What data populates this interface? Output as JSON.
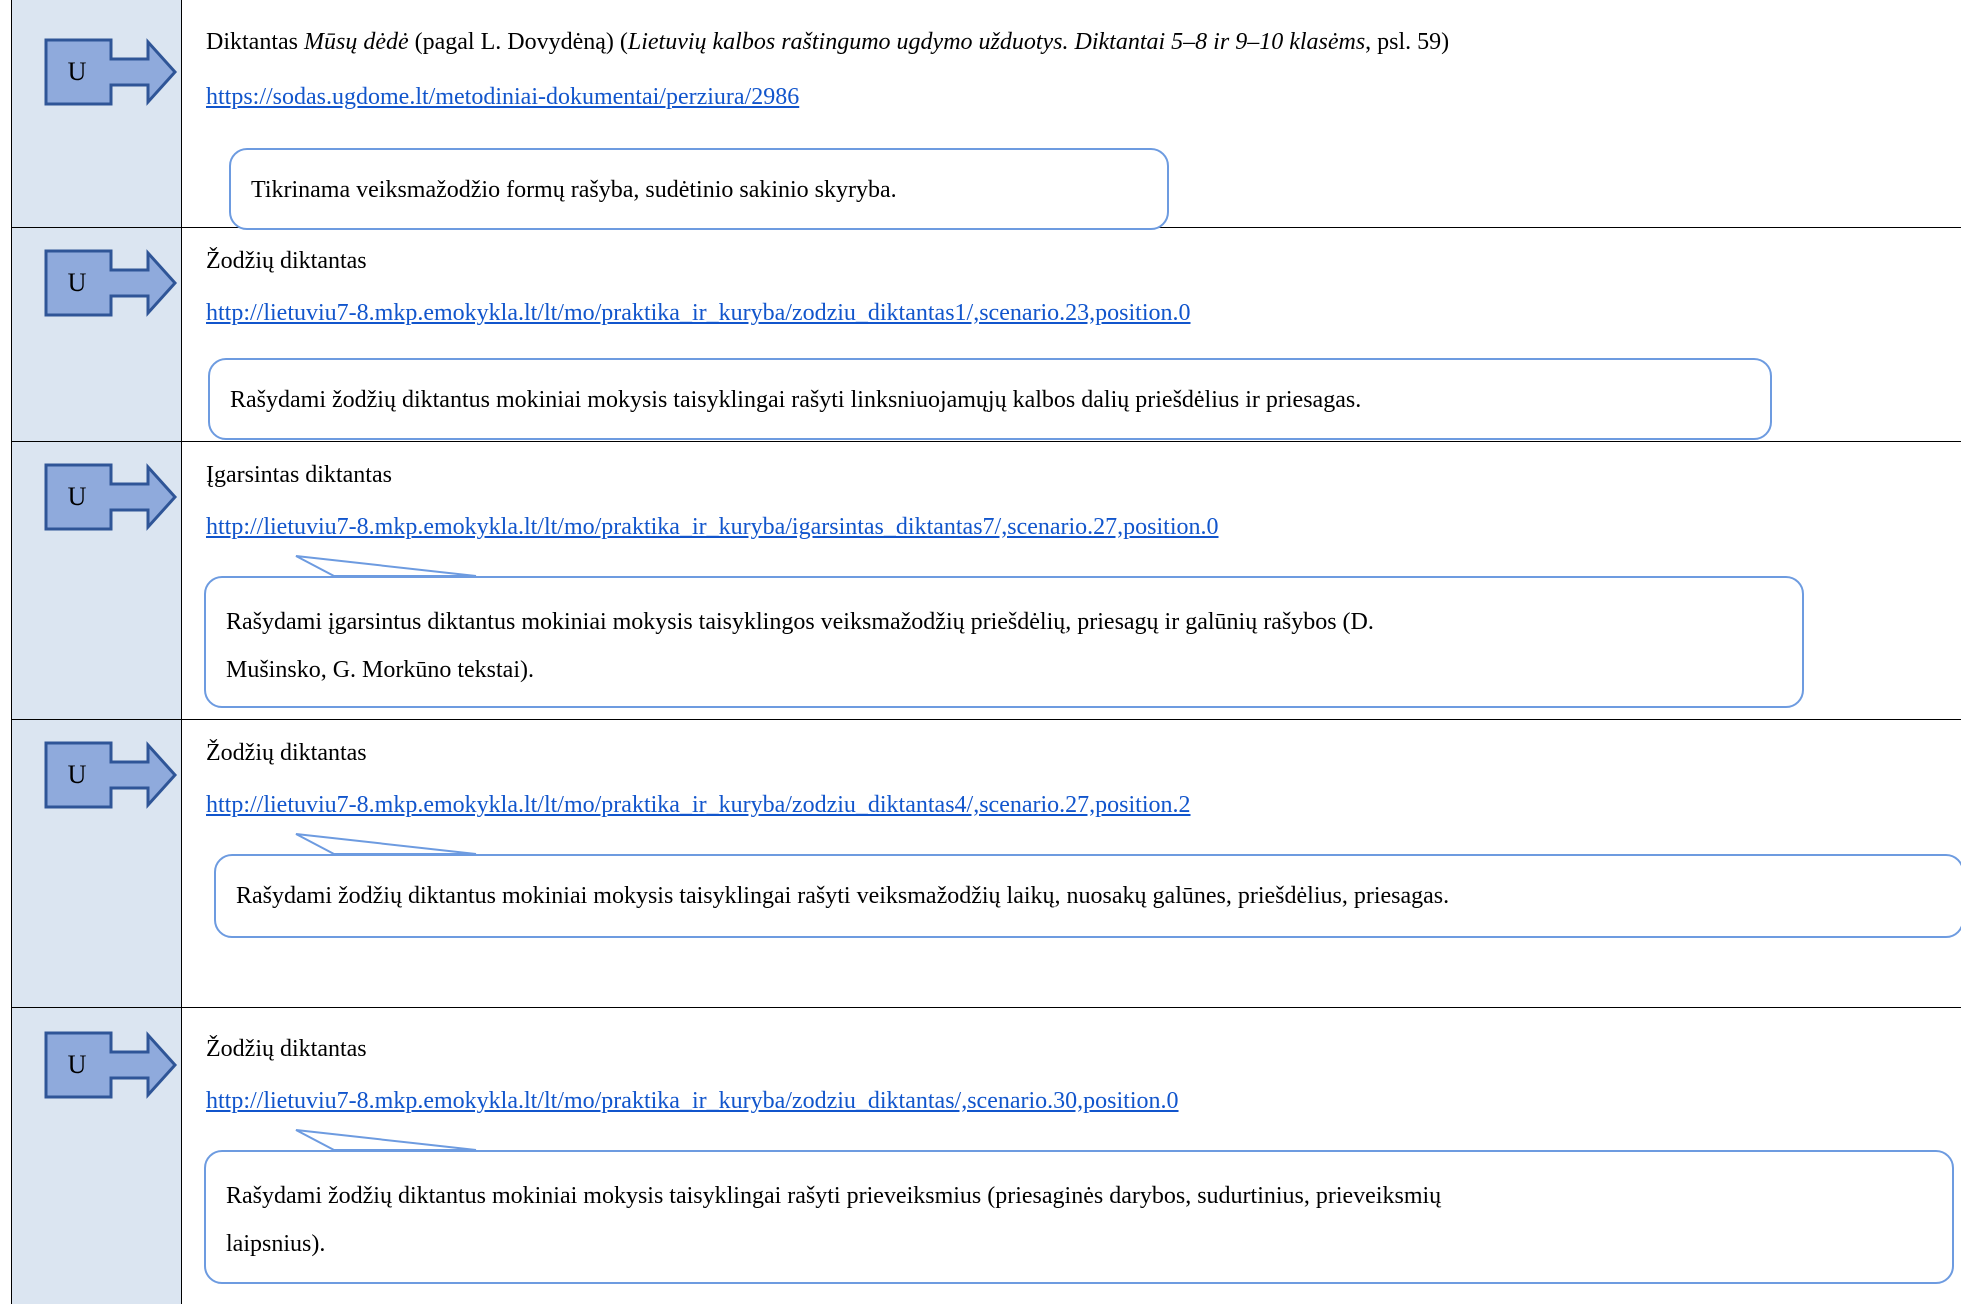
{
  "badge_letter": "U",
  "colors": {
    "sidebar": "#dbe5f1",
    "badge_fill": "#8faadc",
    "badge_border": "#2f5597",
    "link": "#1155cc",
    "callout_border": "#6d9be0"
  },
  "icons": [
    "u-badge-arrow-icon"
  ],
  "entries": [
    {
      "title_prefix": "Diktantas ",
      "title_italic": "Mūsų dėdė",
      "title_mid": " (pagal L. Dovydėną) (",
      "title_italic2": "Lietuvių kalbos raštingumo ugdymo užduotys. Diktantai 5–8 ir 9–10 klasėms",
      "title_suffix": ", psl. 59)",
      "link": "https://sodas.ugdome.lt/metodiniai-dokumentai/perziura/2986",
      "note": "Tikrinama veiksmažodžio formų rašyba, sudėtinio sakinio skyryba."
    },
    {
      "title": "Žodžių diktantas",
      "link": "http://lietuviu7-8.mkp.emokykla.lt/lt/mo/praktika_ir_kuryba/zodziu_diktantas1/,scenario.23,position.0",
      "note": "Rašydami žodžių diktantus mokiniai mokysis taisyklingai rašyti linksniuojamųjų kalbos dalių priešdėlius ir priesagas."
    },
    {
      "title": "Įgarsintas diktantas",
      "link": "http://lietuviu7-8.mkp.emokykla.lt/lt/mo/praktika_ir_kuryba/igarsintas_diktantas7/,scenario.27,position.0",
      "note_line1": "Rašydami įgarsintus diktantus mokiniai mokysis taisyklingos veiksmažodžių priešdėlių, priesagų ir galūnių rašybos (D.",
      "note_line2": "Mušinsko, G. Morkūno tekstai)."
    },
    {
      "title": "Žodžių diktantas",
      "link": "http://lietuviu7-8.mkp.emokykla.lt/lt/mo/praktika_ir_kuryba/zodziu_diktantas4/,scenario.27,position.2",
      "note": "Rašydami žodžių diktantus mokiniai mokysis taisyklingai rašyti veiksmažodžių laikų, nuosakų galūnes, priešdėlius, priesagas."
    },
    {
      "title": "Žodžių diktantas",
      "link": "http://lietuviu7-8.mkp.emokykla.lt/lt/mo/praktika_ir_kuryba/zodziu_diktantas/,scenario.30,position.0",
      "note_line1": "Rašydami žodžių diktantus mokiniai mokysis taisyklingai rašyti prieveiksmius (priesaginės darybos, sudurtinius, prieveiksmių",
      "note_line2": "laipsnius)."
    }
  ]
}
